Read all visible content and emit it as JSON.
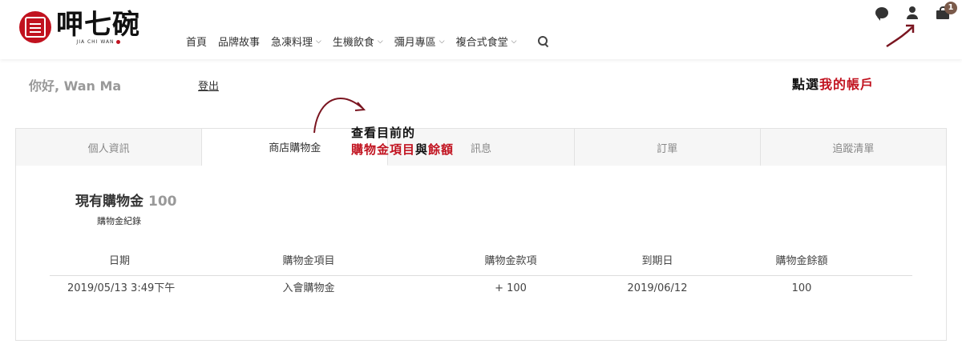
{
  "logo": {
    "brand": "呷七碗",
    "subtitle": "JIA CHI WAN"
  },
  "nav": {
    "items": [
      {
        "label": "首頁",
        "has_dropdown": false
      },
      {
        "label": "品牌故事",
        "has_dropdown": false
      },
      {
        "label": "急凍料理",
        "has_dropdown": true
      },
      {
        "label": "生機飲食",
        "has_dropdown": true
      },
      {
        "label": "彌月專區",
        "has_dropdown": true
      },
      {
        "label": "複合式食堂",
        "has_dropdown": true
      }
    ],
    "chevron": "⌄",
    "search_icon": "search-icon"
  },
  "top_icons": {
    "chat_icon": "chat-icon",
    "user_icon": "user-icon",
    "cart_icon": "shopping-bag-icon",
    "cart_count": "1"
  },
  "annotations": {
    "account_prefix": "點選",
    "account_highlight": "我的帳戶",
    "tab_line1": "查看目前的",
    "tab_highlight1": "購物金項目",
    "tab_mid": "與",
    "tab_highlight2": "餘額"
  },
  "account": {
    "greeting": "你好, Wan Ma",
    "logout": "登出"
  },
  "tabs": [
    {
      "label": "個人資訊",
      "active": false
    },
    {
      "label": "商店購物金",
      "active": true
    },
    {
      "label": "訊息",
      "active": false
    },
    {
      "label": "訂單",
      "active": false
    },
    {
      "label": "追蹤清單",
      "active": false
    }
  ],
  "credit": {
    "balance_label": "現有購物金",
    "balance_value": "100",
    "records_label": "購物金紀錄",
    "columns": [
      "日期",
      "購物金項目",
      "購物金款項",
      "到期日",
      "購物金餘額"
    ],
    "rows": [
      [
        "2019/05/13 3:49下午",
        "入會購物金",
        "+ 100",
        "2019/06/12",
        "100"
      ]
    ]
  },
  "colors": {
    "accent_red": "#c1121f",
    "badge": "#7a5a4a",
    "border": "#e2e2e2",
    "muted_text": "#999999"
  }
}
